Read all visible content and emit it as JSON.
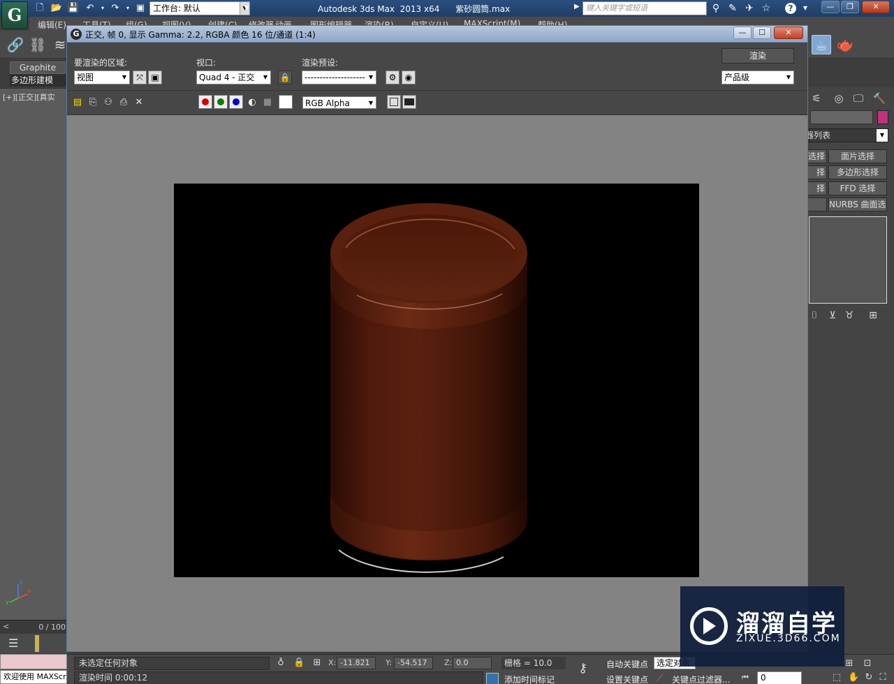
{
  "app": {
    "logo_letter": "G",
    "title": "Autodesk 3ds Max  2013 x64      紫砂圆筒.max",
    "workspace_label": "工作台: 默认",
    "search_placeholder": "键入关键字或短语"
  },
  "menubar": {
    "items": [
      "编辑(E)",
      "工具(T)",
      "组(G)",
      "视图(V)",
      "创建(C)",
      "修改器",
      "动画",
      "图形编辑器",
      "渲染(R)",
      "自定义(U)",
      "MAXScript(M)",
      "帮助(H)"
    ]
  },
  "ribbon": {
    "graphite_tab": "Graphite",
    "poly_tab": "多边形建模"
  },
  "viewport": {
    "label": "[+][正交][真实"
  },
  "timeline": {
    "frame_counter": "0 / 100"
  },
  "listener": {
    "welcome": "欢迎使用 MAXScr"
  },
  "command_panel": {
    "modifier_list": "修改器列表",
    "color_swatch": "#c4307c",
    "buttons": [
      "面片选择",
      "多边形选择",
      "FFD 选择",
      "NURBS 曲面选择"
    ],
    "left_fragments": [
      "选择",
      "择",
      "择"
    ]
  },
  "render_window": {
    "title": "正交, 帧 0, 显示 Gamma: 2.2, RGBA 颜色 16 位/通道 (1:4)",
    "area_label": "要渲染的区域:",
    "area_value": "视图",
    "viewport_label": "视口:",
    "viewport_value": "Quad 4 - 正交",
    "preset_label": "渲染预设:",
    "preset_value": "--------------------",
    "render_button": "渲染",
    "quality_value": "产品级",
    "channel_value": "RGB Alpha",
    "channel_colors": [
      "#d00000",
      "#008000",
      "#0000d0"
    ],
    "object_color": "#5a200f"
  },
  "status_bar": {
    "prompt": "未选定任何对象",
    "render_time": "渲染时间  0:00:12",
    "x_label": "X:",
    "x_value": "-11.821",
    "y_label": "Y:",
    "y_value": "-54.517",
    "z_label": "Z:",
    "z_value": "0.0",
    "grid": "栅格 = 10.0",
    "auto_key": "自动关键点",
    "set_key": "设置关键点",
    "selection": "选定对象",
    "key_filters": "关键点过滤器...",
    "add_time_tag": "添加时间标记",
    "frame": "0"
  },
  "watermark": {
    "title": "溜溜自学",
    "url": "ZIXUE.3D66.COM"
  }
}
